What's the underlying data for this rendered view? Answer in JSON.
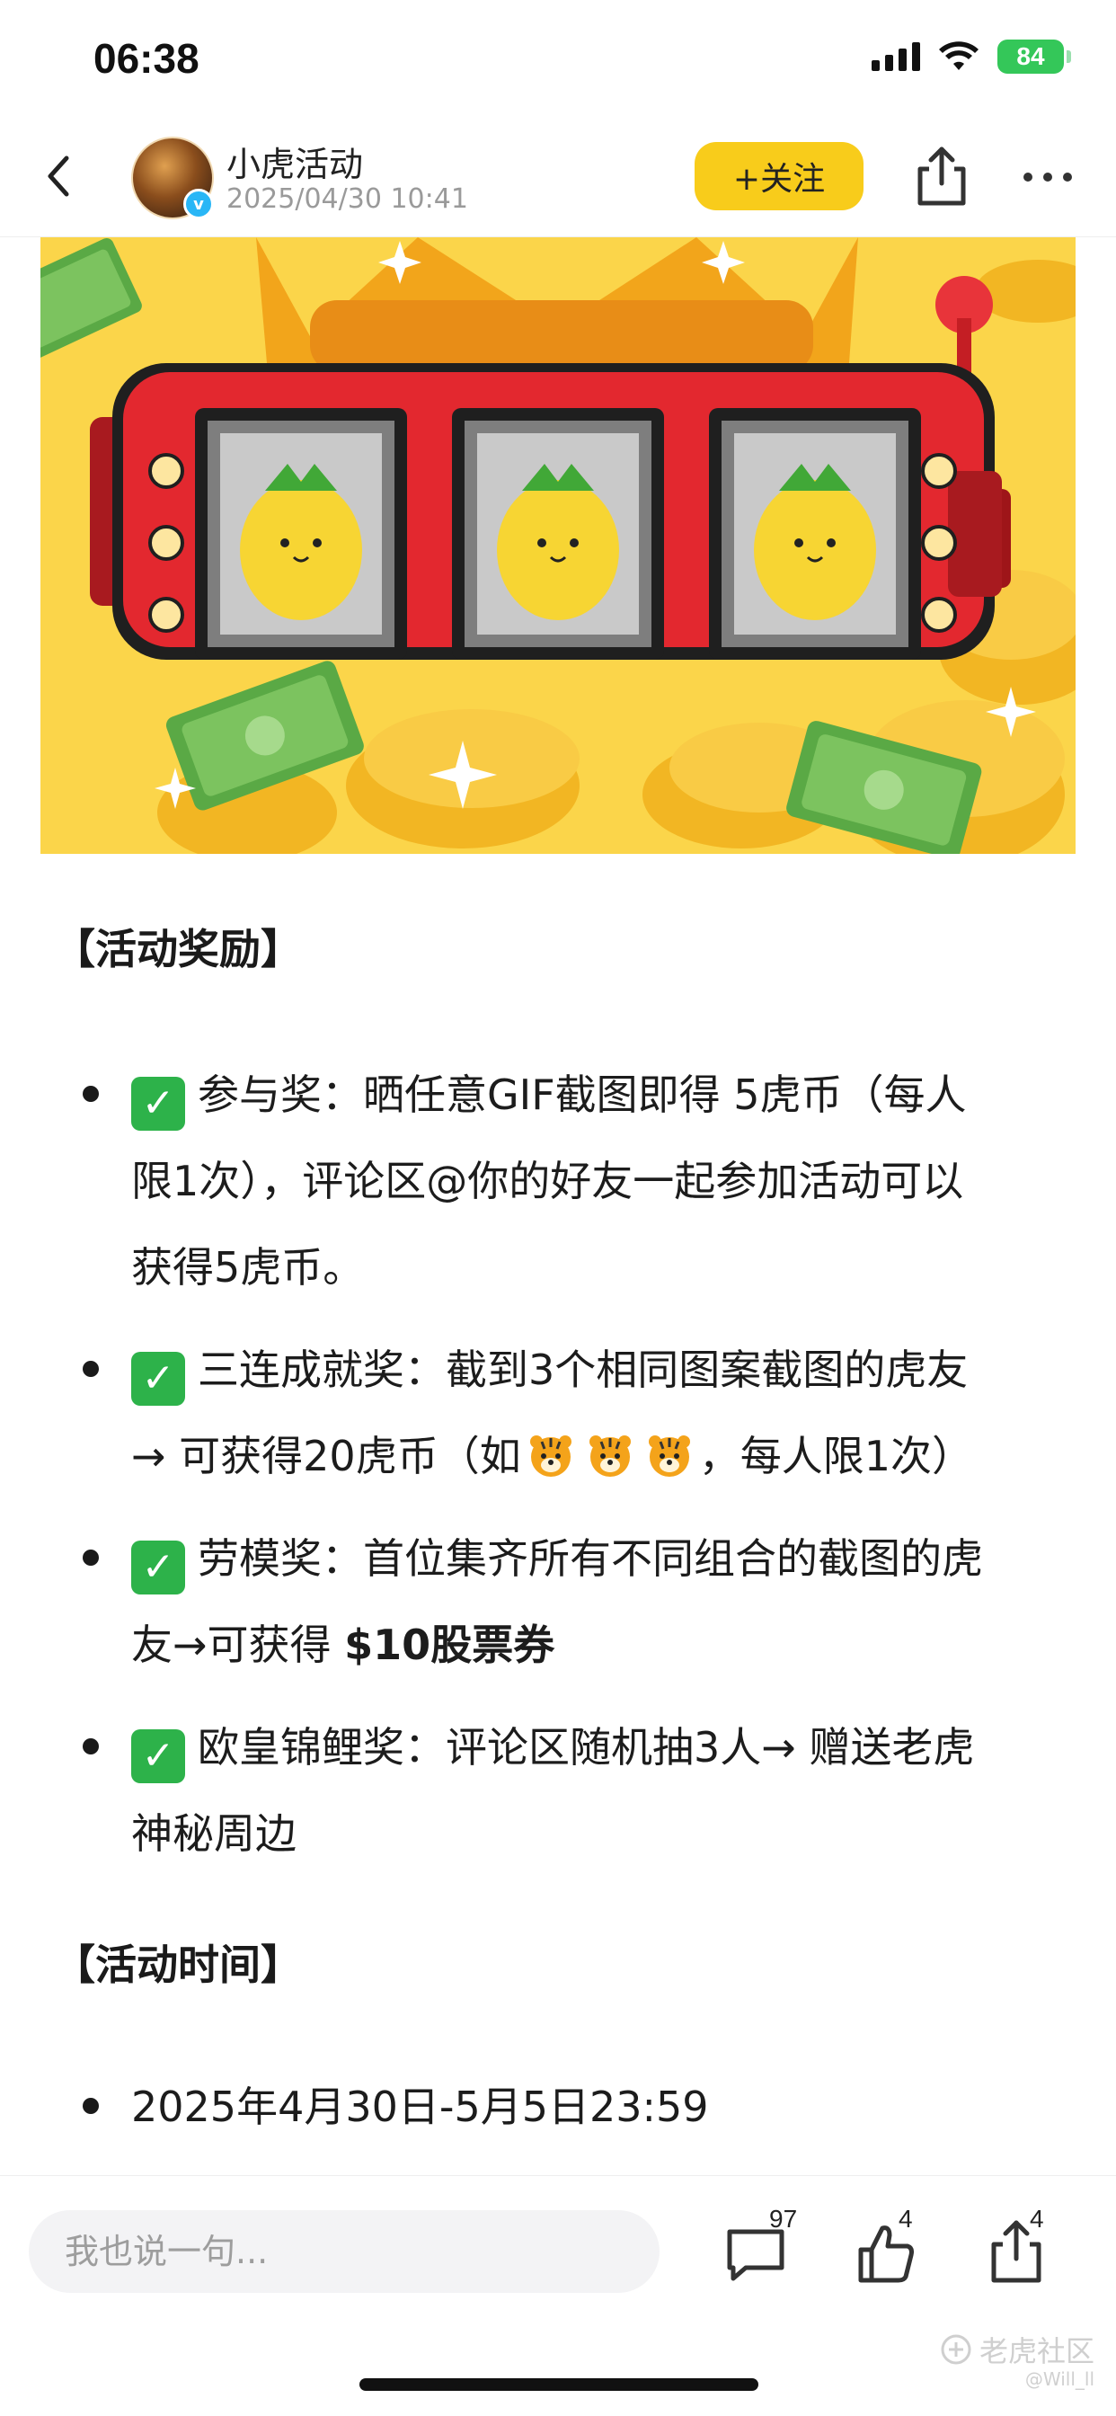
{
  "status_bar": {
    "time": "06:38",
    "battery": "84"
  },
  "header": {
    "author_name": "小虎活动",
    "post_time": "2025/04/30 10:41",
    "follow_label": "+关注"
  },
  "sections": {
    "rewards_title": "【活动奖励】",
    "time_title": "【活动时间】"
  },
  "rewards": [
    {
      "name": "参与奖",
      "text_a": "参与奖：晒任意GIF截图即得 5虎币（每人",
      "text_b": "限1次），评论区@你的好友一起参加活动可以",
      "text_c": "获得5虎币。"
    },
    {
      "name": "三连成就奖",
      "text_a": "三连成就奖：截到3个相同图案截图的虎友",
      "text_b": "→ 可获得20虎币（如",
      "text_c": "，每人限1次）"
    },
    {
      "name": "劳模奖",
      "text_a": "劳模奖：首位集齐所有不同组合的截图的虎",
      "text_b": "友→可获得 ",
      "text_bold": "$10股票券"
    },
    {
      "name": "欧皇锦鲤奖",
      "text_a": "欧皇锦鲤奖：评论区随机抽3人→ 赠送老虎",
      "text_b": "神秘周边"
    }
  ],
  "event_time": "2025年4月30日-5月5日23:59",
  "bottom_bar": {
    "comment_placeholder": "我也说一句...",
    "comment_count": "97",
    "like_count": "4",
    "share_count": "4"
  },
  "watermark": {
    "brand": "老虎社区",
    "handle": "@Will_ll"
  },
  "colors": {
    "follow_bg": "#f8cc1b",
    "check_green": "#2db24a",
    "battery_green": "#34c759"
  }
}
